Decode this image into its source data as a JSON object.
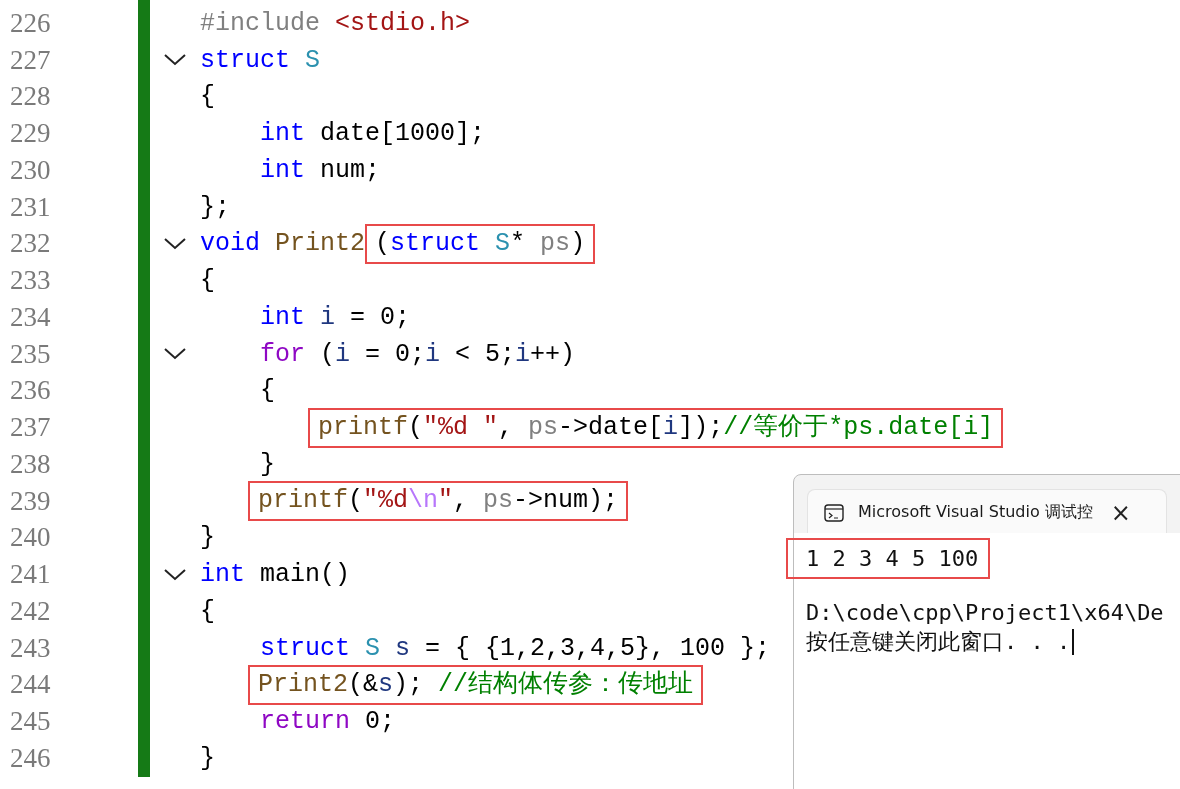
{
  "editor": {
    "lines": [
      {
        "number": "226",
        "collapsible": false,
        "code": [
          {
            "kind": "preproc",
            "text": "#include "
          },
          {
            "kind": "include",
            "text": "<stdio.h>"
          }
        ]
      },
      {
        "number": "227",
        "collapsible": true,
        "code": [
          {
            "kind": "keyword",
            "text": "struct "
          },
          {
            "kind": "type",
            "text": "S"
          }
        ]
      },
      {
        "number": "228",
        "collapsible": false,
        "code": [
          {
            "kind": "plain",
            "text": "{"
          }
        ],
        "children": [
          {
            "number": "229",
            "collapsible": false,
            "code": [
              {
                "kind": "keyword",
                "text": "int "
              },
              {
                "kind": "plain",
                "text": "date[1000];"
              }
            ]
          },
          {
            "number": "230",
            "collapsible": false,
            "code": [
              {
                "kind": "keyword",
                "text": "int "
              },
              {
                "kind": "plain",
                "text": "num;"
              }
            ]
          }
        ]
      },
      {
        "number": "231",
        "collapsible": false,
        "code": [
          {
            "kind": "plain",
            "text": "};"
          }
        ]
      },
      {
        "number": "232",
        "collapsible": true,
        "code": [
          {
            "kind": "keyword",
            "text": "void "
          },
          {
            "kind": "func",
            "text": "Print2"
          }
        ],
        "highlight": [
          {
            "kind": "plain",
            "text": "("
          },
          {
            "kind": "keyword",
            "text": "struct "
          },
          {
            "kind": "type",
            "text": "S"
          },
          {
            "kind": "plain",
            "text": "* "
          },
          {
            "kind": "param",
            "text": "ps"
          },
          {
            "kind": "plain",
            "text": ")"
          }
        ]
      },
      {
        "number": "233",
        "collapsible": false,
        "code": [
          {
            "kind": "plain",
            "text": "{"
          }
        ],
        "children": [
          {
            "number": "234",
            "collapsible": false,
            "code": [
              {
                "kind": "keyword",
                "text": "int "
              },
              {
                "kind": "local",
                "text": "i"
              },
              {
                "kind": "plain",
                "text": " = 0;"
              }
            ]
          },
          {
            "number": "235",
            "collapsible": true,
            "code": [
              {
                "kind": "control",
                "text": "for "
              },
              {
                "kind": "plain",
                "text": "("
              },
              {
                "kind": "local",
                "text": "i"
              },
              {
                "kind": "plain",
                "text": " = 0;"
              },
              {
                "kind": "local",
                "text": "i"
              },
              {
                "kind": "plain",
                "text": " < 5;"
              },
              {
                "kind": "local",
                "text": "i"
              },
              {
                "kind": "plain",
                "text": "++)"
              }
            ]
          },
          {
            "number": "236",
            "collapsible": false,
            "code": [
              {
                "kind": "plain",
                "text": "{"
              }
            ],
            "children": [
              {
                "number": "237",
                "collapsible": false,
                "highlight": [
                  {
                    "kind": "func",
                    "text": "printf"
                  },
                  {
                    "kind": "plain",
                    "text": "("
                  },
                  {
                    "kind": "string",
                    "text": "\"%d \""
                  },
                  {
                    "kind": "plain",
                    "text": ", "
                  },
                  {
                    "kind": "param",
                    "text": "ps"
                  },
                  {
                    "kind": "plain",
                    "text": "->date["
                  },
                  {
                    "kind": "local",
                    "text": "i"
                  },
                  {
                    "kind": "plain",
                    "text": "]);"
                  },
                  {
                    "kind": "comment",
                    "text": "//等价于*ps.date[i]"
                  }
                ]
              }
            ]
          },
          {
            "number": "238",
            "collapsible": false,
            "code": [
              {
                "kind": "plain",
                "text": "}"
              }
            ]
          },
          {
            "number": "239",
            "collapsible": false,
            "highlight": [
              {
                "kind": "func",
                "text": "printf"
              },
              {
                "kind": "plain",
                "text": "("
              },
              {
                "kind": "string",
                "text": "\"%d"
              },
              {
                "kind": "escape",
                "text": "\\n"
              },
              {
                "kind": "string",
                "text": "\""
              },
              {
                "kind": "plain",
                "text": ", "
              },
              {
                "kind": "param",
                "text": "ps"
              },
              {
                "kind": "plain",
                "text": "->num);"
              }
            ]
          }
        ]
      },
      {
        "number": "240",
        "collapsible": false,
        "code": [
          {
            "kind": "plain",
            "text": "}"
          }
        ]
      },
      {
        "number": "241",
        "collapsible": true,
        "code": [
          {
            "kind": "keyword",
            "text": "int "
          },
          {
            "kind": "plain",
            "text": "main()"
          }
        ]
      },
      {
        "number": "242",
        "collapsible": false,
        "code": [
          {
            "kind": "plain",
            "text": "{"
          }
        ],
        "children": [
          {
            "number": "243",
            "collapsible": false,
            "code": [
              {
                "kind": "keyword",
                "text": "struct "
              },
              {
                "kind": "type",
                "text": "S "
              },
              {
                "kind": "local",
                "text": "s"
              },
              {
                "kind": "plain",
                "text": " = { {1,2,3,4,5}, 100 };"
              }
            ]
          },
          {
            "number": "244",
            "collapsible": false,
            "highlight": [
              {
                "kind": "func",
                "text": "Print2"
              },
              {
                "kind": "plain",
                "text": "(&"
              },
              {
                "kind": "local",
                "text": "s"
              },
              {
                "kind": "plain",
                "text": "); "
              },
              {
                "kind": "comment",
                "text": "//结构体传参：传地址"
              }
            ]
          },
          {
            "number": "245",
            "collapsible": false,
            "code": [
              {
                "kind": "control",
                "text": "return "
              },
              {
                "kind": "plain",
                "text": "0;"
              }
            ]
          }
        ]
      },
      {
        "number": "246",
        "collapsible": false,
        "code": [
          {
            "kind": "plain",
            "text": "}"
          }
        ]
      }
    ]
  },
  "console": {
    "tab_title": "Microsoft Visual Studio 调试控",
    "close": "×",
    "output": [
      {
        "text": "1 2 3 4 5 100",
        "boxed": true
      },
      {
        "text": "D:\\code\\cpp\\Project1\\x64\\De",
        "boxed": false
      },
      {
        "text": "按任意键关闭此窗口. . .",
        "boxed": false,
        "cursor": true
      }
    ]
  }
}
